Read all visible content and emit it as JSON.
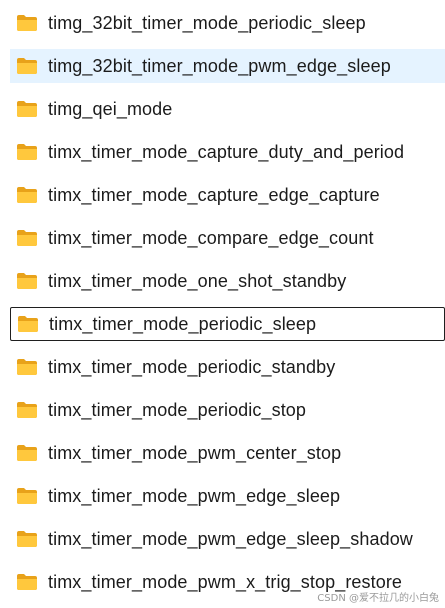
{
  "colors": {
    "folder_back": "#e8a21a",
    "folder_front": "#ffc83d",
    "hover_background": "#e5f3ff",
    "text": "#1b1b1b"
  },
  "hover_row_index": 1,
  "focused_row_index": 7,
  "items": [
    {
      "label": "timg_32bit_timer_mode_periodic_sleep",
      "icon": "folder-icon"
    },
    {
      "label": "timg_32bit_timer_mode_pwm_edge_sleep",
      "icon": "folder-icon"
    },
    {
      "label": "timg_qei_mode",
      "icon": "folder-icon"
    },
    {
      "label": "timx_timer_mode_capture_duty_and_period",
      "icon": "folder-icon"
    },
    {
      "label": "timx_timer_mode_capture_edge_capture",
      "icon": "folder-icon"
    },
    {
      "label": "timx_timer_mode_compare_edge_count",
      "icon": "folder-icon"
    },
    {
      "label": "timx_timer_mode_one_shot_standby",
      "icon": "folder-icon"
    },
    {
      "label": "timx_timer_mode_periodic_sleep",
      "icon": "folder-icon"
    },
    {
      "label": "timx_timer_mode_periodic_standby",
      "icon": "folder-icon"
    },
    {
      "label": "timx_timer_mode_periodic_stop",
      "icon": "folder-icon"
    },
    {
      "label": "timx_timer_mode_pwm_center_stop",
      "icon": "folder-icon"
    },
    {
      "label": "timx_timer_mode_pwm_edge_sleep",
      "icon": "folder-icon"
    },
    {
      "label": "timx_timer_mode_pwm_edge_sleep_shadow",
      "icon": "folder-icon"
    },
    {
      "label": "timx_timer_mode_pwm_x_trig_stop_restore",
      "icon": "folder-icon"
    }
  ],
  "watermark": "CSDN @爱不拉几的小白兔"
}
